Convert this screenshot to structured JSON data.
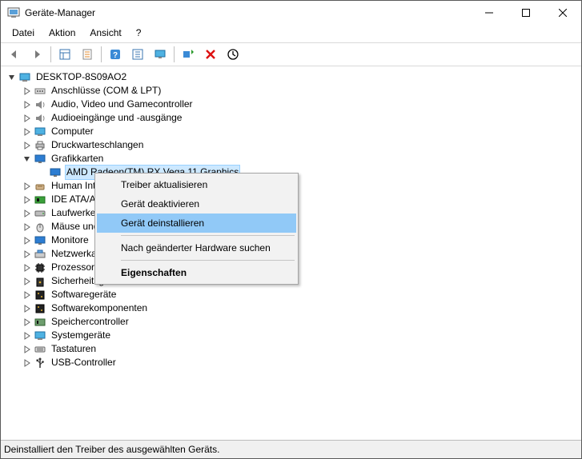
{
  "window": {
    "title": "Geräte-Manager"
  },
  "menu": {
    "file": "Datei",
    "action": "Aktion",
    "view": "Ansicht",
    "help": "?"
  },
  "toolbar": {
    "back": "back",
    "forward": "forward",
    "showhide": "showhide",
    "properties": "properties",
    "help": "help",
    "action1": "action1",
    "monitor": "monitor",
    "scan": "scan",
    "remove": "remove",
    "update": "update"
  },
  "tree": {
    "root": "DESKTOP-8S09AO2",
    "nodes": {
      "ports": "Anschlüsse (COM & LPT)",
      "avgame": "Audio, Video und Gamecontroller",
      "audio": "Audioeingänge und -ausgänge",
      "computer": "Computer",
      "print": "Druckwarteschlangen",
      "display": "Grafikkarten",
      "gpu": "AMD Radeon(TM) RX Vega 11 Graphics",
      "hid": "Human Interface Devices",
      "ide": "IDE ATA/ATAPI-Controller",
      "drive": "Laufwerke",
      "mouse": "Mäuse und andere Zeigegeräte",
      "monitor": "Monitore",
      "net": "Netzwerkadapter",
      "cpu": "Prozessoren",
      "sec": "Sicherheitsgeräte",
      "swdev": "Softwaregeräte",
      "swcomp": "Softwarekomponenten",
      "storage": "Speichercontroller",
      "sysdev": "Systemgeräte",
      "keyboard": "Tastaturen",
      "usb": "USB-Controller"
    }
  },
  "contextmenu": {
    "update": "Treiber aktualisieren",
    "disable": "Gerät deaktivieren",
    "uninstall": "Gerät deinstallieren",
    "scan": "Nach geänderter Hardware suchen",
    "props": "Eigenschaften"
  },
  "status": "Deinstalliert den Treiber des ausgewählten Geräts."
}
